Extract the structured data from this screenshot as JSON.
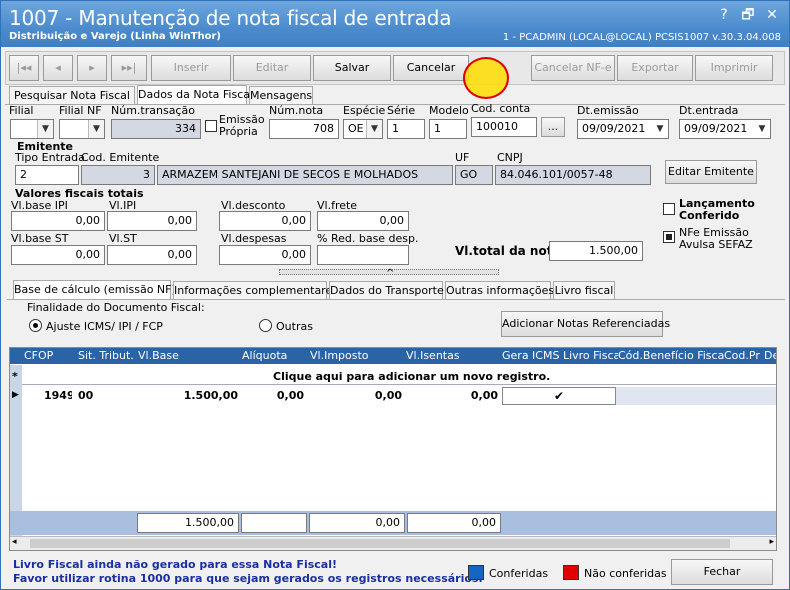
{
  "window": {
    "title": "1007 - Manutenção de nota fiscal de entrada",
    "subtitle": "Distribuição e Varejo (Linha WinThor)",
    "info": "1 - PCADMIN (LOCAL@LOCAL)   PCSIS1007  v.30.3.04.008",
    "help": "?",
    "minimize": "🗗",
    "close": "✕"
  },
  "toolbar": {
    "first": "|◂◂",
    "prev": "◂",
    "next": "▸",
    "last": "▸▸|",
    "insert": "Inserir",
    "edit": "Editar",
    "save": "Salvar",
    "cancel": "Cancelar",
    "cancel_nfe": "Cancelar NF-e",
    "export": "Exportar",
    "print": "Imprimir"
  },
  "tabs": {
    "search": "Pesquisar Nota Fiscal",
    "data": "Dados da Nota Fiscal",
    "messages": "Mensagens"
  },
  "labels": {
    "filial": "Filial",
    "filial_nf": "Filial NF",
    "num_transacao": "Núm.transação",
    "emissao_propria": "Emissão\nPrópria",
    "num_nota": "Núm.nota",
    "especie": "Espécie",
    "serie": "Série",
    "modelo": "Modelo",
    "cod_conta": "Cod. conta",
    "dt_emissao": "Dt.emissão",
    "dt_entrada": "Dt.entrada",
    "emitente": "Emitente",
    "tipo_entrada": "Tipo Entrada",
    "cod_emitente": "Cod. Emitente",
    "uf": "UF",
    "cnpj": "CNPJ",
    "valores": "Valores fiscais totais",
    "vl_base_ipi": "Vl.base IPI",
    "vl_ipi": "Vl.IPI",
    "vl_desconto": "Vl.desconto",
    "vl_frete": "Vl.frete",
    "vl_base_st": "Vl.base ST",
    "vl_st": "Vl.ST",
    "vl_despesas": "Vl.despesas",
    "red_base": "% Red. base desp.",
    "vl_total": "Vl.total da nota:",
    "lancamento": "Lançamento\nConferido",
    "nfe_emissao": "NFe Emissão\nAvulsa SEFAZ"
  },
  "values": {
    "num_transacao": "334",
    "num_nota": "708",
    "especie": "OE",
    "serie": "1",
    "modelo": "1",
    "cod_conta": "100010",
    "dt_emissao": "09/09/2021",
    "dt_entrada": "09/09/2021",
    "tipo_entrada": "2",
    "cod_emitente": "3",
    "emitente_nome": "ARMAZEM SANTEJANI DE SECOS E MOLHADOS",
    "uf": "GO",
    "cnpj": "84.046.101/0057-48",
    "vl_base_ipi": "0,00",
    "vl_ipi": "0,00",
    "vl_desconto": "0,00",
    "vl_frete": "0,00",
    "vl_base_st": "0,00",
    "vl_st": "0,00",
    "vl_despesas": "0,00",
    "red_base": "",
    "vl_total": "1.500,00",
    "ellipsis": "...",
    "collapse": "^"
  },
  "buttons": {
    "editar_emitente": "Editar Emitente",
    "adicionar_notas": "Adicionar Notas Referenciadas",
    "fechar": "Fechar"
  },
  "subtabs": [
    "Base de cálculo (emissão NF)",
    "Informações complementares",
    "Dados do Transporte",
    "Outras informações",
    "Livro fiscal"
  ],
  "finalidade": {
    "label": "Finalidade do Documento Fiscal:",
    "opt1": "Ajuste ICMS/ IPI / FCP",
    "opt2": "Outras"
  },
  "grid": {
    "headers": [
      "CFOP",
      "Sit. Tribut.",
      "Vl.Base",
      "Alíquota",
      "Vl.Imposto",
      "Vl.Isentas",
      "Gera ICMS Livro Fiscal",
      "Cód.Benefício Fiscal",
      "Cod.Pr",
      "De"
    ],
    "add_row": "Clique aqui para adicionar um novo registro.",
    "new_marker": "*",
    "row_marker": "▶",
    "row": {
      "cfop": "1949",
      "sit": "00",
      "base": "1.500,00",
      "aliquota": "0,00",
      "imposto": "0,00",
      "isentas": "0,00",
      "check": "✔"
    },
    "totals": {
      "base": "1.500,00",
      "imposto": "0,00",
      "isentas": "0,00"
    }
  },
  "footer": {
    "line1": "Livro Fiscal ainda não gerado para essa Nota Fiscal!",
    "line2": "Favor utilizar rotina 1000 para que sejam gerados os registros necessários.",
    "conferidas": "Conferidas",
    "nao_conferidas": "Não conferidas"
  },
  "colors": {
    "conferidas": "#1565c0",
    "nao_conferidas": "#e00000",
    "header": "#2a63a6",
    "footer_text": "#1a2fa0"
  }
}
